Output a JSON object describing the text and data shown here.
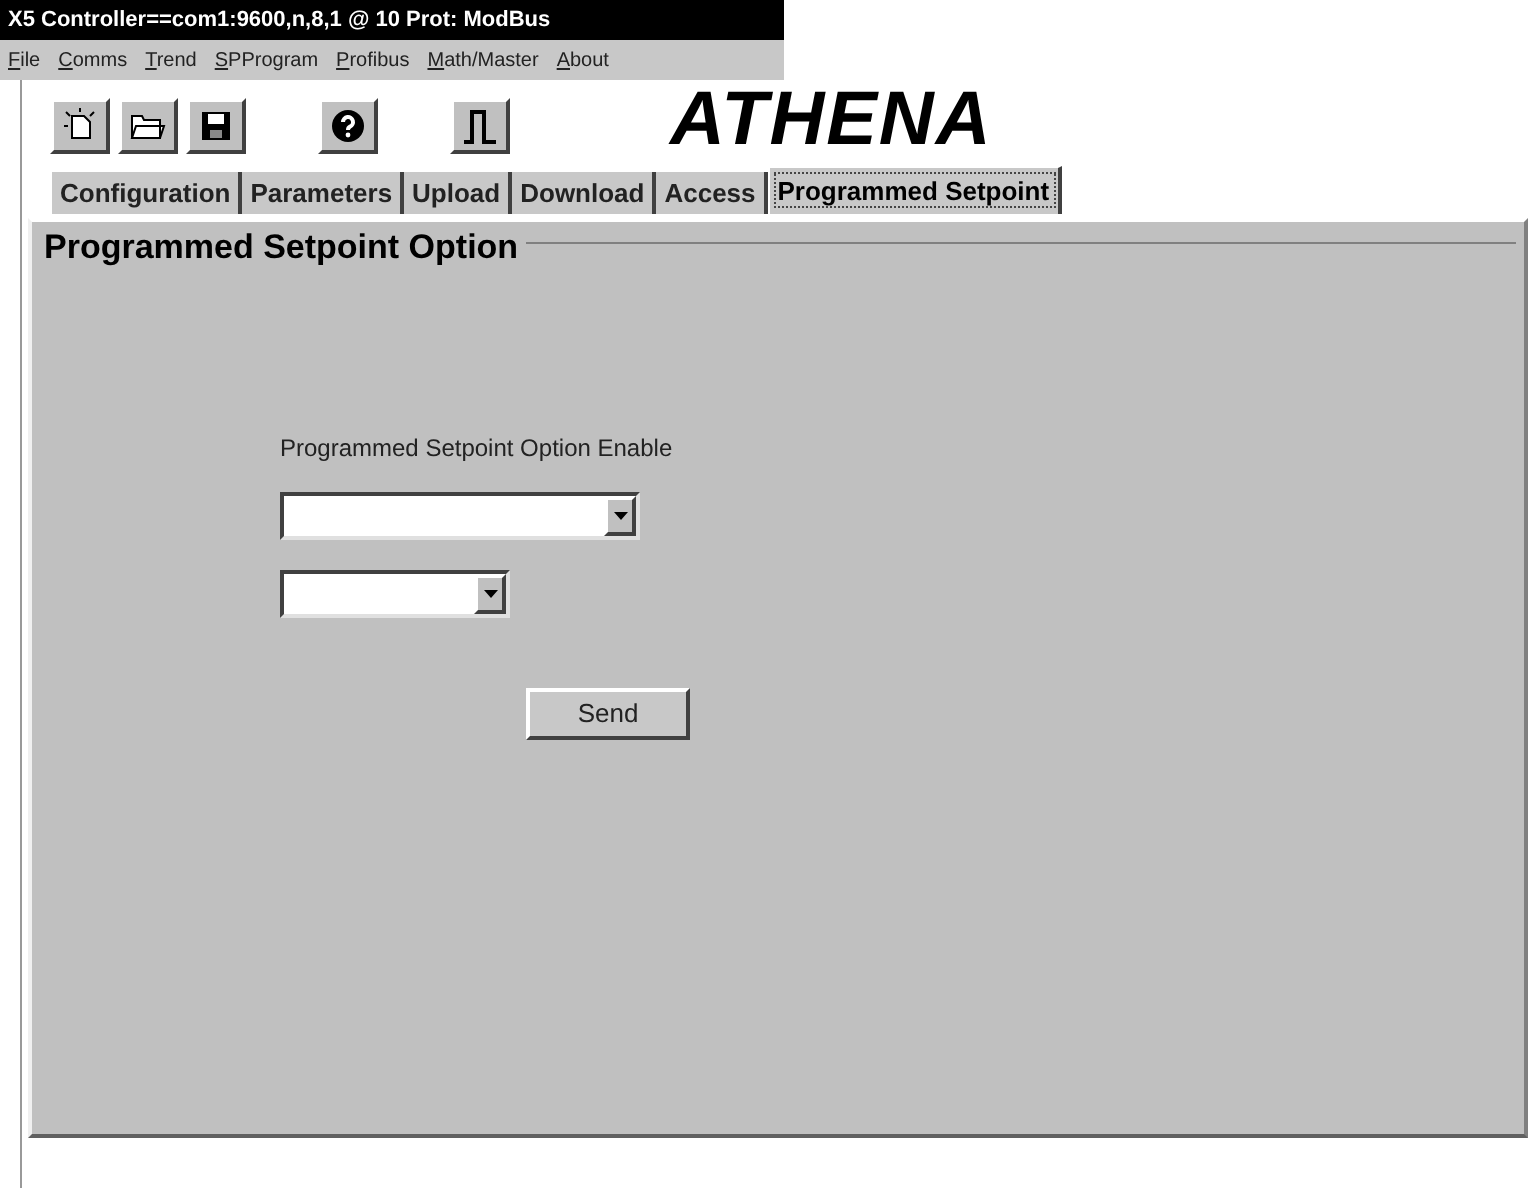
{
  "window": {
    "title": "X5 Controller==com1:9600,n,8,1 @ 10 Prot: ModBus"
  },
  "menu": [
    {
      "label": "File",
      "underlined_initial": true
    },
    {
      "label": "Comms",
      "underlined_initial": true
    },
    {
      "label": "Trend",
      "underlined_initial": true
    },
    {
      "label": "SPProgram",
      "underlined_initial": true
    },
    {
      "label": "Profibus",
      "underlined_initial": true
    },
    {
      "label": "Math/Master",
      "underlined_initial": true
    },
    {
      "label": "About",
      "underlined_initial": true
    }
  ],
  "toolbar": [
    {
      "kind": "new"
    },
    {
      "kind": "open"
    },
    {
      "kind": "save"
    },
    {
      "kind": "help"
    },
    {
      "kind": "pulse"
    }
  ],
  "logo": "ATHENA",
  "tabs": [
    {
      "label": "Configuration",
      "selected": false
    },
    {
      "label": "Parameters",
      "selected": false
    },
    {
      "label": "Upload",
      "selected": false
    },
    {
      "label": "Download",
      "selected": false
    },
    {
      "label": "Access",
      "selected": false
    },
    {
      "label": "Programmed Setpoint",
      "selected": true
    }
  ],
  "group": {
    "title": "Programmed Setpoint Option",
    "label": "Programmed Setpoint Option Enable",
    "dropdowns": [
      {
        "kind": "wide"
      },
      {
        "kind": "narrow"
      }
    ],
    "button": "Send"
  }
}
